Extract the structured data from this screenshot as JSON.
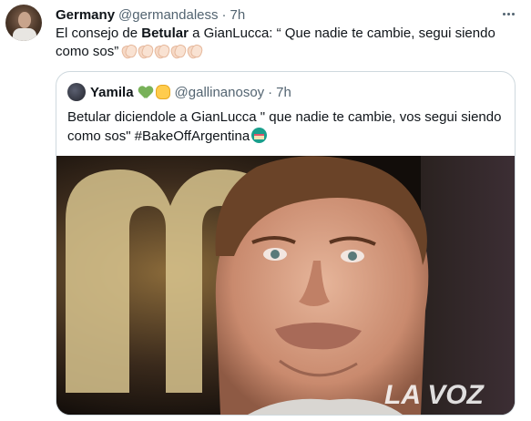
{
  "tweet": {
    "author_name": "Germany",
    "author_handle": "@germandaless",
    "separator": "·",
    "time": "7h",
    "text_part1": "El consejo de ",
    "text_bold": "Betular",
    "text_part2": " a GianLucca: “ Que nadie te cambie, segui siendo como sos”",
    "clap_count": 5
  },
  "quoted": {
    "author_name": "Yamila",
    "author_handle": "@gallinanosoy",
    "separator": "·",
    "time": "7h",
    "text": "Betular diciendole a GianLucca \" que nadie te cambie, vos segui siendo como sos\" #BakeOffArgentina",
    "watermark": "LA VOZ"
  },
  "icons": [
    "avatar",
    "more-horizontal-icon",
    "clap-icon",
    "green-heart-icon",
    "fist-icon",
    "cake-icon"
  ]
}
